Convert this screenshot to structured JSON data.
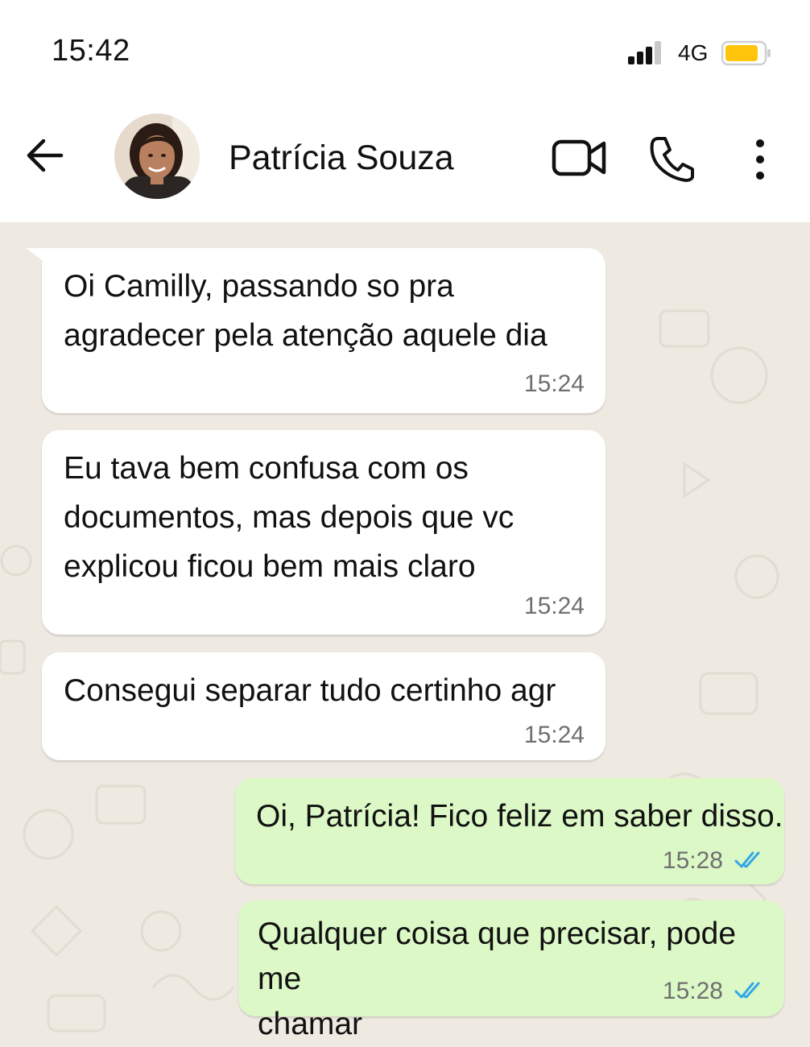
{
  "status_bar": {
    "time": "15:42",
    "network": "4G",
    "signal_icon": "signal-bars-icon",
    "battery_icon": "battery-icon",
    "battery_color": "#ffc40c"
  },
  "header": {
    "contact_name": "Patrícia Souza",
    "back_icon": "arrow-left-icon",
    "video_icon": "video-camera-icon",
    "call_icon": "phone-icon",
    "more_icon": "vertical-dots-icon"
  },
  "colors": {
    "incoming_bubble": "#ffffff",
    "outgoing_bubble": "#dcf8c7",
    "chat_background": "#eee9e1",
    "read_ticks": "#34a8e6"
  },
  "messages": [
    {
      "direction": "incoming",
      "lines": [
        "Oi Camilly, passando so pra",
        "agradecer pela atenção aquele dia"
      ],
      "time": "15:24"
    },
    {
      "direction": "incoming",
      "lines": [
        "Eu tava bem confusa com os",
        "documentos, mas depois que vc",
        "explicou ficou bem mais claro"
      ],
      "time": "15:24"
    },
    {
      "direction": "incoming",
      "lines": [
        "Consegui separar tudo certinho agr"
      ],
      "time": "15:24"
    },
    {
      "direction": "outgoing",
      "lines": [
        "Oi, Patrícia! Fico feliz em saber disso."
      ],
      "time": "15:28",
      "status_icon": "double-check-read-icon"
    },
    {
      "direction": "outgoing",
      "lines": [
        "Qualquer coisa que precisar, pode me",
        "chamar"
      ],
      "time": "15:28",
      "status_icon": "double-check-read-icon"
    }
  ]
}
